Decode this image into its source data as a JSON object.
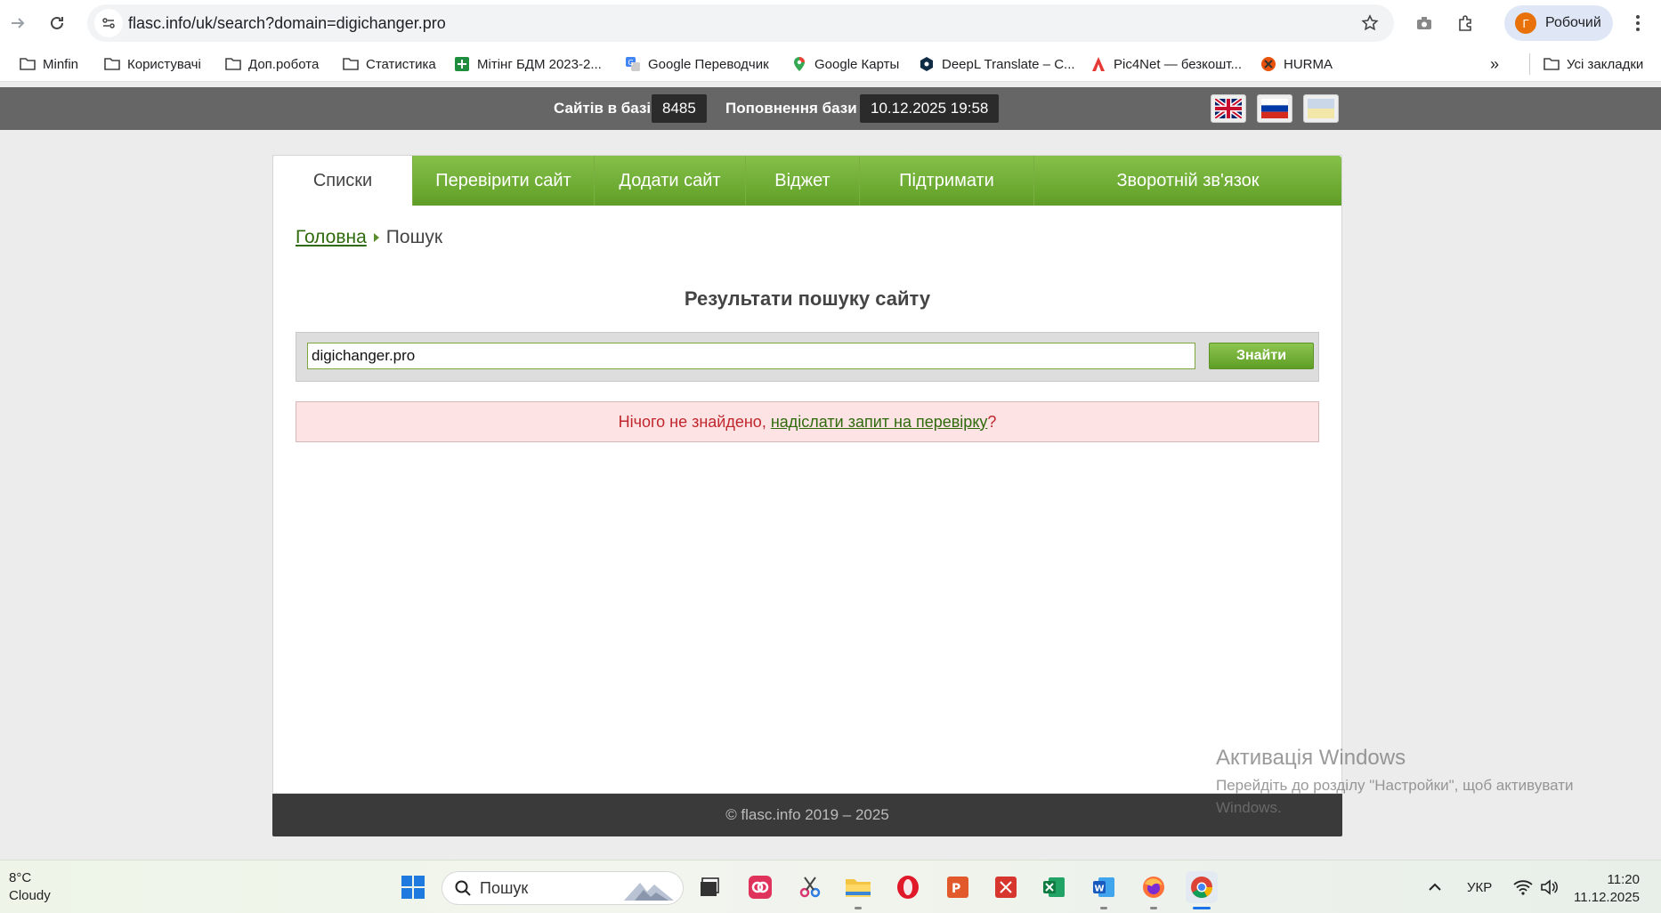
{
  "browser": {
    "url": "flasc.info/uk/search?domain=digichanger.pro",
    "profile_initial": "Г",
    "profile_name": "Робочий",
    "bookmarks": [
      {
        "label": "Minfin",
        "icon": "folder-icon"
      },
      {
        "label": "Користувачі",
        "icon": "folder-icon"
      },
      {
        "label": "Доп.робота",
        "icon": "folder-icon"
      },
      {
        "label": "Статистика",
        "icon": "folder-icon"
      },
      {
        "label": "Мітінг БДМ 2023-2...",
        "icon": "sheets-icon"
      },
      {
        "label": "Google Переводчик",
        "icon": "translate-icon"
      },
      {
        "label": "Google Карты",
        "icon": "maps-icon"
      },
      {
        "label": "DeepL Translate – C...",
        "icon": "deepl-icon"
      },
      {
        "label": "Pic4Net — безкошт...",
        "icon": "pic4net-icon"
      },
      {
        "label": "HURMA",
        "icon": "hurma-icon"
      }
    ],
    "all_bookmarks": "Усі закладки",
    "overflow": "»"
  },
  "statbar": {
    "sites_label": "Сайтів в базі",
    "sites_count": "8485",
    "update_label": "Поповнення бази",
    "update_date": "10.12.2025 19:58",
    "languages": [
      "en",
      "ru",
      "uk"
    ]
  },
  "nav": {
    "tabs": [
      "Списки",
      "Перевірити сайт",
      "Додати сайт",
      "Віджет",
      "Підтримати",
      "Зворотній зв'язок"
    ]
  },
  "breadcrumb": {
    "home": "Головна",
    "current": "Пошук"
  },
  "search": {
    "title": "Результати пошуку сайту",
    "value": "digichanger.pro",
    "button": "Знайти"
  },
  "alert": {
    "text": "Нічого не знайдено, ",
    "link": "надіслати запит на перевірку",
    "suffix": "?"
  },
  "footer": {
    "text": "© flasc.info 2019 – 2025"
  },
  "watermark": {
    "title": "Активація Windows",
    "subtitle": "Перейдіть до розділу \"Настройки\", щоб активувати Windows."
  },
  "taskbar": {
    "temperature": "8°C",
    "weather": "Cloudy",
    "search_placeholder": "Пошук",
    "language": "УКР",
    "time": "11:20",
    "date": "11.12.2025"
  },
  "colors": {
    "accent_green": "#6aab30",
    "link_green": "#2f6b0d",
    "alert_red": "#c0262d",
    "alert_bg": "#fde3e3",
    "statbar_bg": "#666666",
    "footer_bg": "#3a3a3a"
  }
}
